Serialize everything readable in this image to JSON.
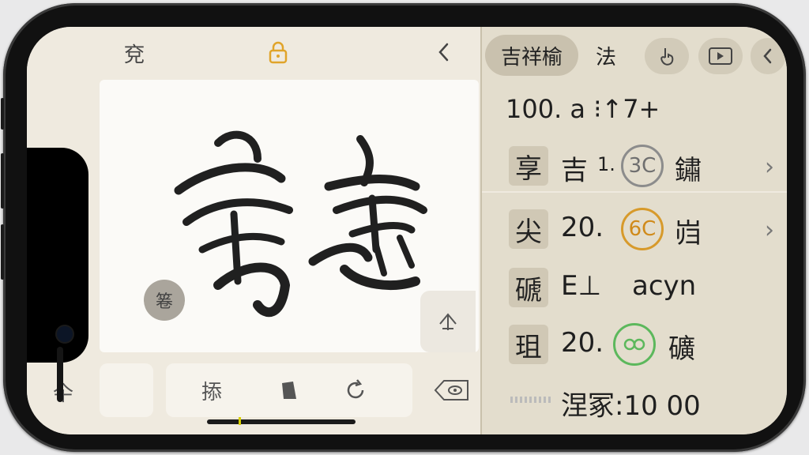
{
  "left": {
    "top_bar": {
      "left_glyph": "兗",
      "lock_icon": "lock-icon",
      "back_icon": "chevron-left-icon"
    },
    "canvas": {
      "badge_glyph": "箞",
      "arrow_icon": "direction-arrow-icon"
    },
    "bottom": {
      "left_glyph": "仐",
      "tool_1": "掭",
      "tool_2_icon": "book-icon",
      "tool_3_icon": "refresh-icon",
      "delete_icon": "delete-icon"
    }
  },
  "right": {
    "tabs": [
      {
        "label": "吉祥榆",
        "active": true
      },
      {
        "label": "法",
        "active": false
      }
    ],
    "tab_icons": [
      "touch-icon",
      "video-icon",
      "chevron-left-icon"
    ],
    "header_line": "100. a ⁝↑7+",
    "rows": [
      {
        "char": "享",
        "pre": "吉",
        "num": "1.",
        "badge": "3C",
        "badge_color": "#8c8c8c",
        "post": "鏽",
        "chevron": true
      },
      {
        "char": "尖",
        "pre": "",
        "num": "20.",
        "badge": "6C",
        "badge_color": "#d79a2b",
        "post": "岿",
        "chevron": true
      },
      {
        "char": "磃",
        "pre": "",
        "num": "E⊥",
        "badge": "",
        "badge_color": "",
        "post": "acyn",
        "chevron": false
      },
      {
        "char": "珇",
        "pre": "",
        "num": "20.",
        "badge": "꙰",
        "badge_color": "#5cb85c",
        "post": "礦",
        "chevron": false
      }
    ],
    "footer": "涅冢:10 00",
    "colors": {
      "accent_lock": "#e0a42a"
    }
  }
}
